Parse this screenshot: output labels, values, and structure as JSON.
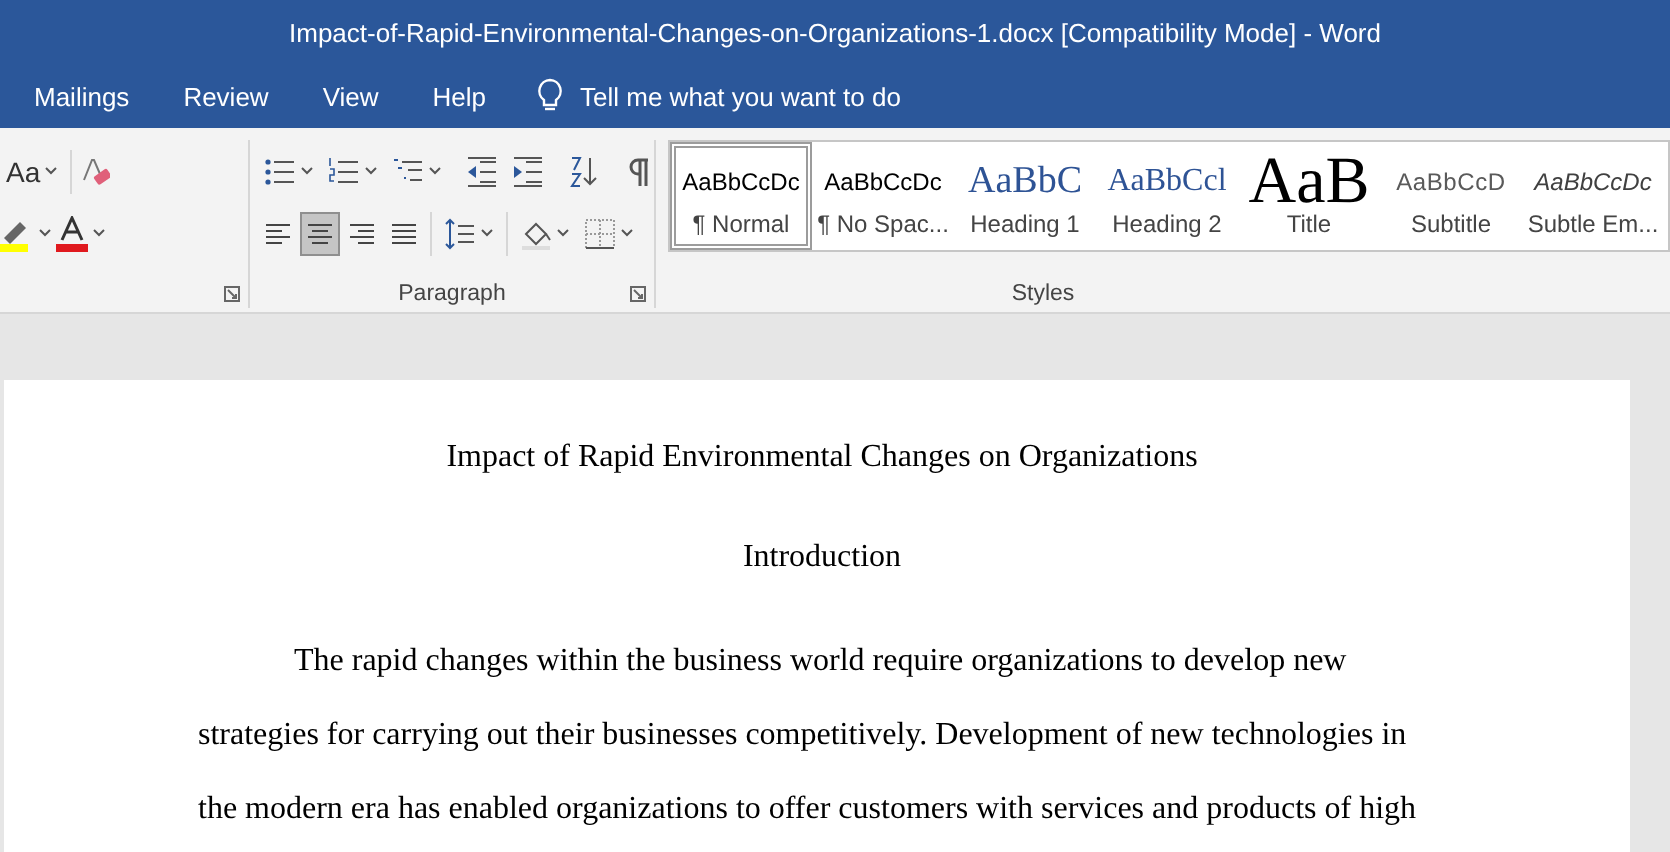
{
  "window": {
    "title": "Impact-of-Rapid-Environmental-Changes-on-Organizations-1.docx [Compatibility Mode]  -  Word"
  },
  "tabs": [
    {
      "label": "Mailings",
      "selected": false
    },
    {
      "label": "Review",
      "selected": false
    },
    {
      "label": "View",
      "selected": false
    },
    {
      "label": "Help",
      "selected": false
    }
  ],
  "tell_me": {
    "placeholder": "Tell me what you want to do"
  },
  "ribbon": {
    "font": {
      "change_case": "Aa"
    },
    "paragraph": {
      "label": "Paragraph",
      "alignment": [
        {
          "kind": "left",
          "selected": false
        },
        {
          "kind": "center",
          "selected": true
        },
        {
          "kind": "right",
          "selected": false
        },
        {
          "kind": "justify",
          "selected": false
        }
      ]
    },
    "styles": {
      "label": "Styles",
      "items": [
        {
          "preview": "AaBbCcDc",
          "name": "¶ Normal",
          "kind": "body",
          "selected": true
        },
        {
          "preview": "AaBbCcDc",
          "name": "¶ No Spac...",
          "kind": "body",
          "selected": false
        },
        {
          "preview": "AaBbC",
          "name": "Heading 1",
          "kind": "heading1",
          "selected": false
        },
        {
          "preview": "AaBbCcl",
          "name": "Heading 2",
          "kind": "heading2",
          "selected": false
        },
        {
          "preview": "AaB",
          "name": "Title",
          "kind": "title",
          "selected": false
        },
        {
          "preview": "AaBbCcD",
          "name": "Subtitle",
          "kind": "subtitle",
          "selected": false
        },
        {
          "preview": "AaBbCcDc",
          "name": "Subtle Em...",
          "kind": "emphasis",
          "selected": false
        }
      ]
    }
  },
  "document": {
    "title": "Impact of Rapid Environmental Changes on Organizations",
    "heading": "Introduction",
    "paragraph": [
      "The rapid changes within the business world require organizations to develop new",
      "strategies for carrying out their businesses competitively. Development of new technologies in",
      "the modern era has enabled organizations to offer customers with services and products of high"
    ]
  }
}
